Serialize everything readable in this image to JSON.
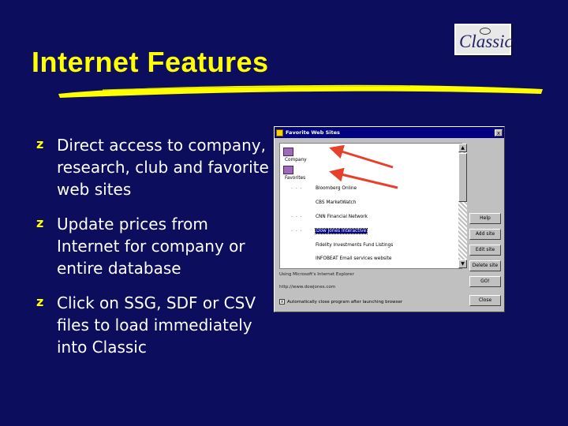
{
  "slide": {
    "title": "Internet Features",
    "bullet_mark": "z",
    "bullets": [
      "Direct access to company, research, club and favorite web sites",
      "Update prices from Internet for company or entire database",
      "Click on SSG, SDF or CSV files to load immediately into Classic"
    ],
    "colors": {
      "background": "#0d0d5e",
      "title": "#ffff00",
      "bullet_text": "#ffffff",
      "arrow": "#e8402a"
    }
  },
  "logo": {
    "text": "Classic"
  },
  "dialog": {
    "title": "Favorite Web Sites",
    "close_label": "x",
    "folders": [
      {
        "label": "Company",
        "icon": "folder-icon"
      },
      {
        "label": "Favorites",
        "icon": "folder-icon"
      }
    ],
    "items": [
      "Bloomberg Online",
      "CBS MarketWatch",
      "CNN Financial Network",
      "Dow Jones Interactive",
      "Fidelity Investments Fund Listings",
      "INFOBEAT Email services website"
    ],
    "selected_item_index": 3,
    "dots": "· · ·",
    "buttons": [
      "Help",
      "Add site",
      "Edit site",
      "Delete site",
      "GO!",
      "Close"
    ],
    "info_lines": [
      "Using Microsoft's Internet Explorer",
      "http://www.dowjones.com"
    ],
    "checkbox_label": "Automatically close program after launching browser",
    "checkbox_checked": true,
    "check_mark": "x",
    "scroll_up": "▲",
    "scroll_down": "▼"
  }
}
